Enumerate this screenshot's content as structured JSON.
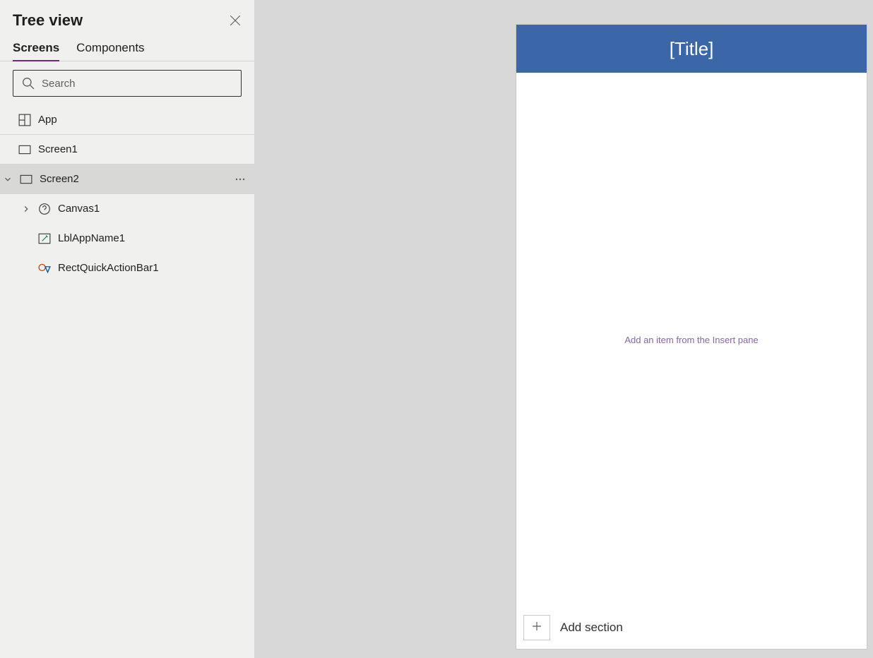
{
  "panel": {
    "title": "Tree view",
    "tabs": {
      "screens": "Screens",
      "components": "Components"
    },
    "search_placeholder": "Search",
    "items": {
      "app": "App",
      "screen1": "Screen1",
      "screen2": "Screen2",
      "canvas1": "Canvas1",
      "lblappname1": "LblAppName1",
      "rectquickactionbar1": "RectQuickActionBar1"
    }
  },
  "preview": {
    "title_text": "[Title]",
    "empty_hint": "Add an item from the Insert pane",
    "add_section": "Add section"
  }
}
